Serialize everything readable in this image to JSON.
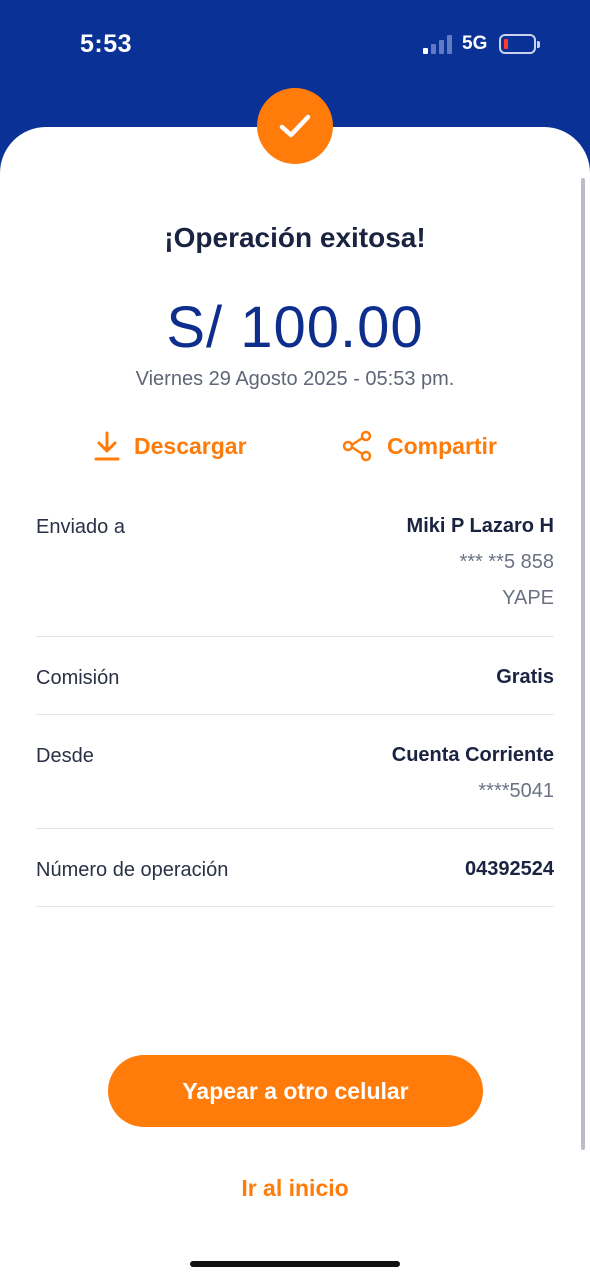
{
  "status_bar": {
    "time": "5:53",
    "network": "5G",
    "battery_level_percent": 5,
    "signal_bars_active": 1
  },
  "receipt": {
    "status_icon": "check-icon",
    "title": "¡Operación exitosa!",
    "amount": "S/ 100.00",
    "datetime": "Viernes 29 Agosto 2025 - 05:53 pm."
  },
  "actions": {
    "download_label": "Descargar",
    "download_icon": "download-icon",
    "share_label": "Compartir",
    "share_icon": "share-icon"
  },
  "details": {
    "sent_to": {
      "label": "Enviado a",
      "name": "Miki P Lazaro H",
      "phone": "*** **5 858",
      "destination": "YAPE"
    },
    "commission": {
      "label": "Comisión",
      "value": "Gratis"
    },
    "from": {
      "label": "Desde",
      "account": "Cuenta Corriente",
      "account_number": "****5041"
    },
    "operation": {
      "label": "Número de operación",
      "value": "04392524"
    }
  },
  "buttons": {
    "primary_label": "Yapear a otro celular",
    "secondary_label": "Ir al inicio"
  },
  "colors": {
    "header_blue": "#0a3196",
    "accent_orange": "#ff7b0a",
    "amount_blue": "#0d2e8c"
  }
}
